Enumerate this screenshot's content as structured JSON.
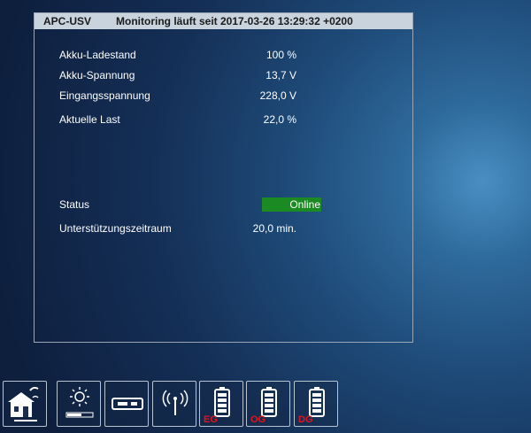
{
  "panel": {
    "device_name": "APC-USV",
    "monitoring_since": "Monitoring läuft seit 2017-03-26 13:29:32 +0200"
  },
  "metrics": [
    {
      "label": "Akku-Ladestand",
      "value": "100 %"
    },
    {
      "label": "Akku-Spannung",
      "value": "13,7 V"
    },
    {
      "label": "Eingangsspannung",
      "value": "228,0 V"
    },
    {
      "label": "Aktuelle Last",
      "value": "22,0 %"
    }
  ],
  "status": {
    "label": "Status",
    "value": "Online",
    "color": "#1b8a23"
  },
  "runtime": {
    "label": "Unterstützungszeitraum",
    "value": "20,0 min."
  },
  "toolbar": {
    "tiles": [
      {
        "icon": "house-weather-icon"
      },
      {
        "icon": "brightness-slider-icon"
      },
      {
        "icon": "media-device-icon"
      },
      {
        "icon": "wireless-antenna-icon"
      },
      {
        "icon": "battery-icon",
        "floor_label": "EG"
      },
      {
        "icon": "battery-icon",
        "floor_label": "OG"
      },
      {
        "icon": "battery-icon",
        "floor_label": "DG"
      }
    ],
    "floor_label_color": "#e0141e"
  }
}
